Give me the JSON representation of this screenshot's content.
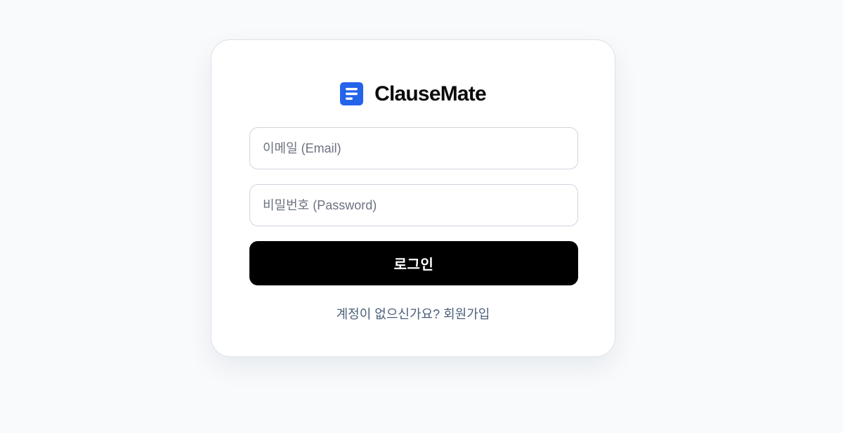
{
  "brand": {
    "icon": "document-lines-icon",
    "name": "ClauseMate"
  },
  "login_form": {
    "email_placeholder": "이메일 (Email)",
    "email_value": "",
    "password_placeholder": "비밀번호 (Password)",
    "password_value": "",
    "submit_label": "로그인"
  },
  "signup": {
    "text": "계정이 없으신가요? 회원가입"
  },
  "colors": {
    "page_background": "#f8fafc",
    "brand_icon": "#2563eb",
    "button_background": "#000000",
    "link_text": "#4b5f7a"
  }
}
